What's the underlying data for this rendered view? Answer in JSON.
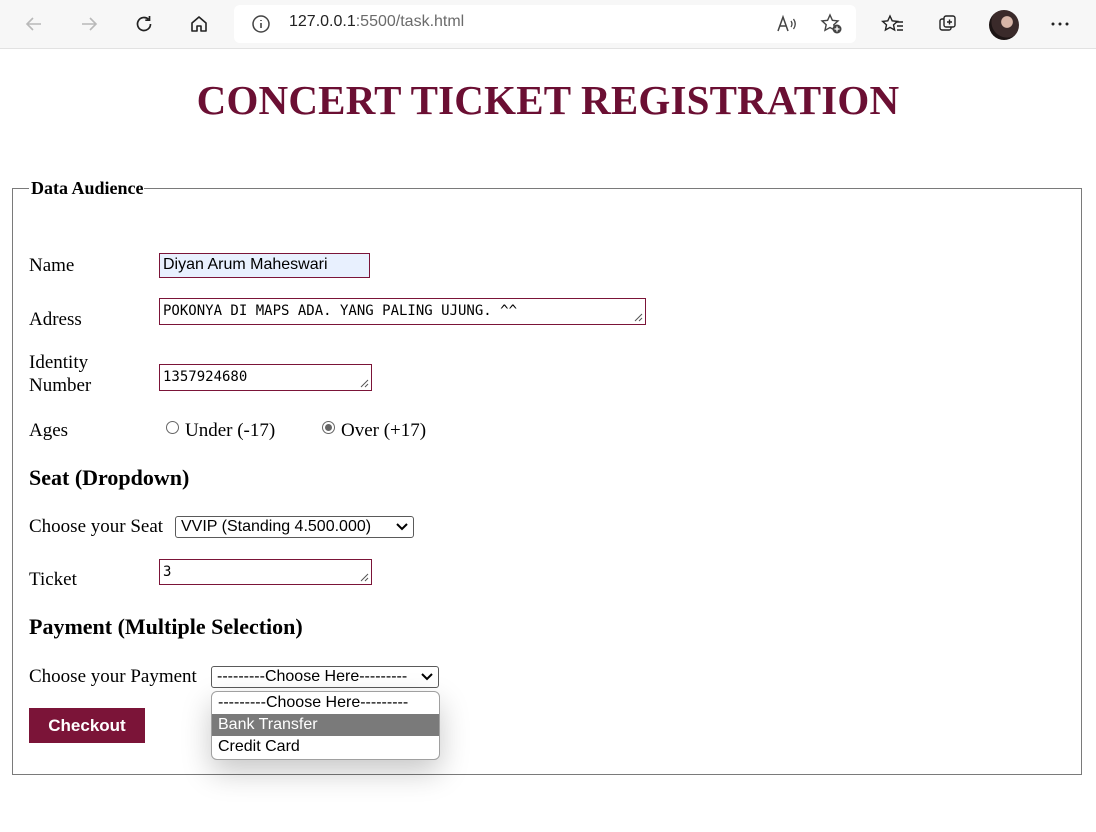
{
  "browser": {
    "url_host": "127.0.0.1",
    "url_rest": ":5500/task.html",
    "icons": [
      "back-icon",
      "forward-icon",
      "refresh-icon",
      "home-icon",
      "info-icon",
      "read-aloud-icon",
      "add-favorite-icon",
      "favorites-icon",
      "collections-icon",
      "profile-avatar",
      "more-icon"
    ]
  },
  "page": {
    "title": "CONCERT TICKET REGISTRATION",
    "legend": "Data Audience",
    "name_label": "Name",
    "name_value": "Diyan Arum Maheswari",
    "address_label": "Adress",
    "address_value": "POKONYA DI MAPS ADA. YANG PALING UJUNG. ^^",
    "identity_label_1": "Identity",
    "identity_label_2": "Number",
    "identity_value": "1357924680",
    "ages_label": "Ages",
    "age_under": "Under (-17)",
    "age_over": "Over (+17)",
    "age_selected": "over",
    "seat_heading": "Seat (Dropdown)",
    "seat_label": "Choose your Seat",
    "seat_value": "VVIP (Standing 4.500.000)",
    "ticket_label": "Ticket",
    "ticket_value": "3",
    "payment_heading": "Payment (Multiple Selection)",
    "payment_label": "Choose your Payment",
    "payment_value": "---------Choose Here---------",
    "payment_options": [
      "---------Choose Here---------",
      "Bank Transfer",
      "Credit Card"
    ],
    "payment_highlighted": "Bank Transfer",
    "checkout_label": "Checkout"
  },
  "colors": {
    "accent": "#7b1438",
    "title": "#6b0f33"
  }
}
